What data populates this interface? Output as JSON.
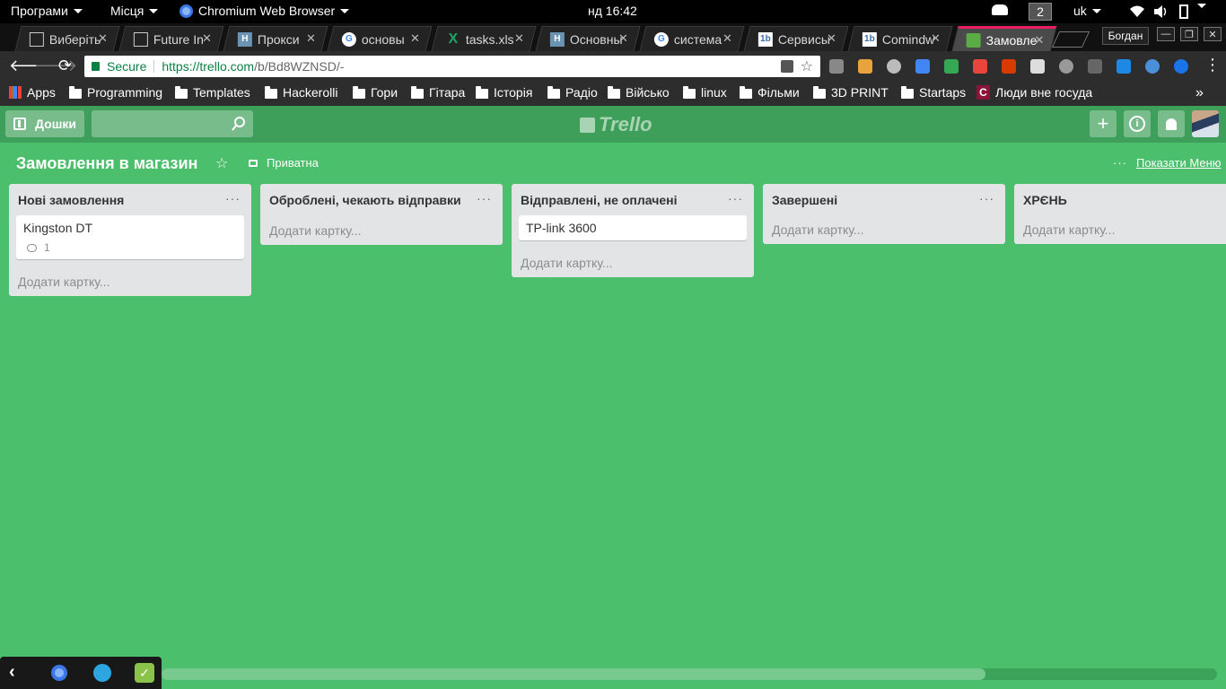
{
  "desktop": {
    "programs": "Програми",
    "places": "Місця",
    "browser": "Chromium Web Browser",
    "clock": "нд 16:42",
    "workspace": "2",
    "lang": "uk"
  },
  "tabs": [
    {
      "label": "Виберіть",
      "favicon": "doc-icon"
    },
    {
      "label": "Future In",
      "favicon": "doc-icon"
    },
    {
      "label": "Прокси",
      "favicon": "h-icon"
    },
    {
      "label": "основы",
      "favicon": "google-icon"
    },
    {
      "label": "tasks.xls",
      "favicon": "excel-icon"
    },
    {
      "label": "Основны",
      "favicon": "h-icon"
    },
    {
      "label": "система",
      "favicon": "google-icon"
    },
    {
      "label": "Сервисы",
      "favicon": "1b-icon"
    },
    {
      "label": "Comindw",
      "favicon": "1b-icon"
    },
    {
      "label": "Замовле",
      "favicon": "trello-icon"
    }
  ],
  "profile": "Богдан",
  "omnibox": {
    "secure": "Secure",
    "url_host": "https://trello.com",
    "url_path": "/b/Bd8WZNSD/-"
  },
  "bookmarks": [
    "Apps",
    "Programming",
    "Templates",
    "Hackerolli",
    "Гори",
    "Гітара",
    "Історія",
    "Радіо",
    "Військо",
    "linux",
    "Фільми",
    "3D PRINT",
    "Startaps",
    "Люди вне госуда"
  ],
  "trello": {
    "boards_label": "Дошки",
    "logo": "Trello",
    "board_name": "Замовлення в магазин",
    "visibility": "Приватна",
    "show_menu": "Показати Меню",
    "add_card": "Додати картку...",
    "lists": [
      {
        "title": "Нові замовлення",
        "cards": [
          {
            "title": "Kingston DT",
            "comments": "1"
          }
        ]
      },
      {
        "title": "Оброблені, чекають відправки",
        "cards": []
      },
      {
        "title": "Відправлені, не оплачені",
        "cards": [
          {
            "title": "TP-link 3600"
          }
        ]
      },
      {
        "title": "Завершені",
        "cards": []
      },
      {
        "title": "ХРЄНЬ",
        "cards": []
      }
    ]
  },
  "colors": {
    "board_bg": "#4bbf6b",
    "header_bg": "#3e9f5a",
    "active_tab_accent": "#e91e63"
  }
}
